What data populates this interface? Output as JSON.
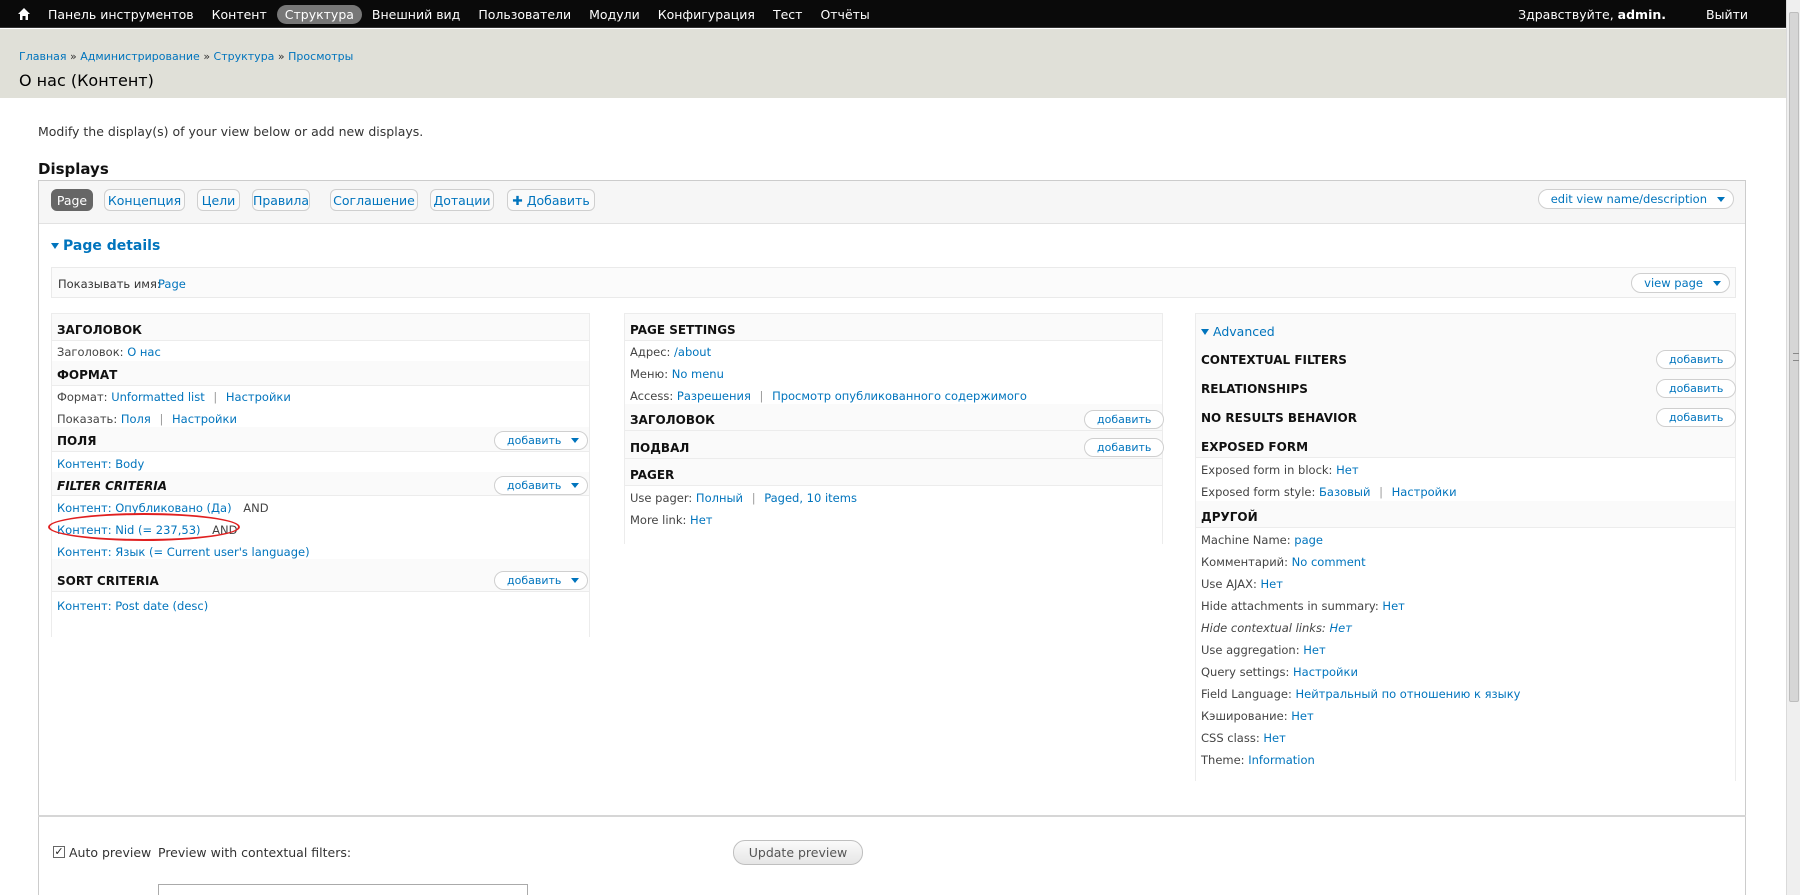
{
  "toolbar": {
    "menu": [
      {
        "label": "Панель инструментов",
        "active": false
      },
      {
        "label": "Контент",
        "active": false
      },
      {
        "label": "Структура",
        "active": true
      },
      {
        "label": "Внешний вид",
        "active": false
      },
      {
        "label": "Пользователи",
        "active": false
      },
      {
        "label": "Модули",
        "active": false
      },
      {
        "label": "Конфигурация",
        "active": false
      },
      {
        "label": "Тест",
        "active": false
      },
      {
        "label": "Отчёты",
        "active": false
      }
    ],
    "greeting": "Здравствуйте,",
    "username": "admin.",
    "logout": "Выйти"
  },
  "breadcrumb": {
    "items": [
      "Главная",
      "Администрирование",
      "Структура",
      "Просмотры"
    ],
    "separator": "»"
  },
  "page_title": "О нас (Контент)",
  "intro": "Modify the display(s) of your view below or add new displays.",
  "displays_title": "Displays",
  "tabs": [
    {
      "label": "Page",
      "active": true
    },
    {
      "label": "Концепция",
      "active": false
    },
    {
      "label": "Цели",
      "active": false
    },
    {
      "label": "Правила",
      "active": false
    },
    {
      "label": "Соглашение",
      "active": false
    },
    {
      "label": "Дотации",
      "active": false
    },
    {
      "label": "✚ Добавить",
      "active": false
    }
  ],
  "edit_view_label": "edit view name/description",
  "page_details_label": "Page details",
  "display_name": {
    "label": "Показывать имя:",
    "value": "Page"
  },
  "view_page_label": "view page",
  "col1": {
    "title_section": {
      "heading": "ЗАГОЛОВОК",
      "label": "Заголовок:",
      "value": "О нас"
    },
    "format_section": {
      "heading": "ФОРМАТ",
      "format_label": "Формат:",
      "format_value": "Unformatted list",
      "format_settings": "Настройки",
      "show_label": "Показать:",
      "show_value": "Поля",
      "show_settings": "Настройки"
    },
    "fields_section": {
      "heading": "ПОЛЯ",
      "add": "добавить",
      "items": [
        "Контент: Body"
      ]
    },
    "filter_section": {
      "heading": "FILTER CRITERIA",
      "add": "добавить",
      "items": [
        {
          "text": "Контент: Опубликовано (Да)",
          "op": "AND"
        },
        {
          "text": "Контент: Nid (= 237,53)",
          "op": "AND"
        },
        {
          "text": "Контент: Язык (= Current user's language)",
          "op": ""
        }
      ]
    },
    "sort_section": {
      "heading": "SORT CRITERIA",
      "add": "добавить",
      "items": [
        "Контент: Post date (desc)"
      ]
    }
  },
  "col2": {
    "page_settings": {
      "heading": "PAGE SETTINGS",
      "path_label": "Адрес:",
      "path_value": "/about",
      "menu_label": "Меню:",
      "menu_value": "No menu",
      "access_label": "Access:",
      "access_value1": "Разрешения",
      "access_value2": "Просмотр опубликованного содержимого"
    },
    "header": {
      "heading": "ЗАГОЛОВОК",
      "add": "добавить"
    },
    "footer": {
      "heading": "ПОДВАЛ",
      "add": "добавить"
    },
    "pager": {
      "heading": "PAGER",
      "use_label": "Use pager:",
      "use_value1": "Полный",
      "use_value2": "Paged, 10 items",
      "more_label": "More link:",
      "more_value": "Нет"
    }
  },
  "col3": {
    "advanced_label": "Advanced",
    "contextual_filters": {
      "heading": "CONTEXTUAL FILTERS",
      "add": "добавить"
    },
    "relationships": {
      "heading": "RELATIONSHIPS",
      "add": "добавить"
    },
    "no_results": {
      "heading": "NO RESULTS BEHAVIOR",
      "add": "добавить"
    },
    "exposed_form": {
      "heading": "EXPOSED FORM",
      "block_label": "Exposed form in block:",
      "block_value": "Нет",
      "style_label": "Exposed form style:",
      "style_value": "Базовый",
      "style_settings": "Настройки"
    },
    "other": {
      "heading": "ДРУГОЙ",
      "rows": [
        {
          "label": "Machine Name:",
          "value": "page",
          "italic": false
        },
        {
          "label": "Комментарий:",
          "value": "No comment",
          "italic": false
        },
        {
          "label": "Use AJAX:",
          "value": "Нет",
          "italic": false
        },
        {
          "label": "Hide attachments in summary:",
          "value": "Нет",
          "italic": false
        },
        {
          "label": "Hide contextual links:",
          "value": "Нет",
          "italic": true
        },
        {
          "label": "Use aggregation:",
          "value": "Нет",
          "italic": false
        },
        {
          "label": "Query settings:",
          "value": "Настройки",
          "italic": false
        },
        {
          "label": "Field Language:",
          "value": "Нейтральный по отношению к языку",
          "italic": false
        },
        {
          "label": "Кэширование:",
          "value": "Нет",
          "italic": false
        },
        {
          "label": "CSS class:",
          "value": "Нет",
          "italic": false
        },
        {
          "label": "Theme:",
          "value": "Information",
          "italic": false
        }
      ]
    }
  },
  "preview": {
    "auto_preview_label": "Auto preview",
    "auto_preview_checked": true,
    "contextual_label": "Preview with contextual filters:",
    "update_button": "Update preview"
  },
  "colors": {
    "link": "#0074bd",
    "toolbar": "#0a0a0a",
    "header_bg": "#e0e0d8",
    "annotation": "#e02020"
  }
}
